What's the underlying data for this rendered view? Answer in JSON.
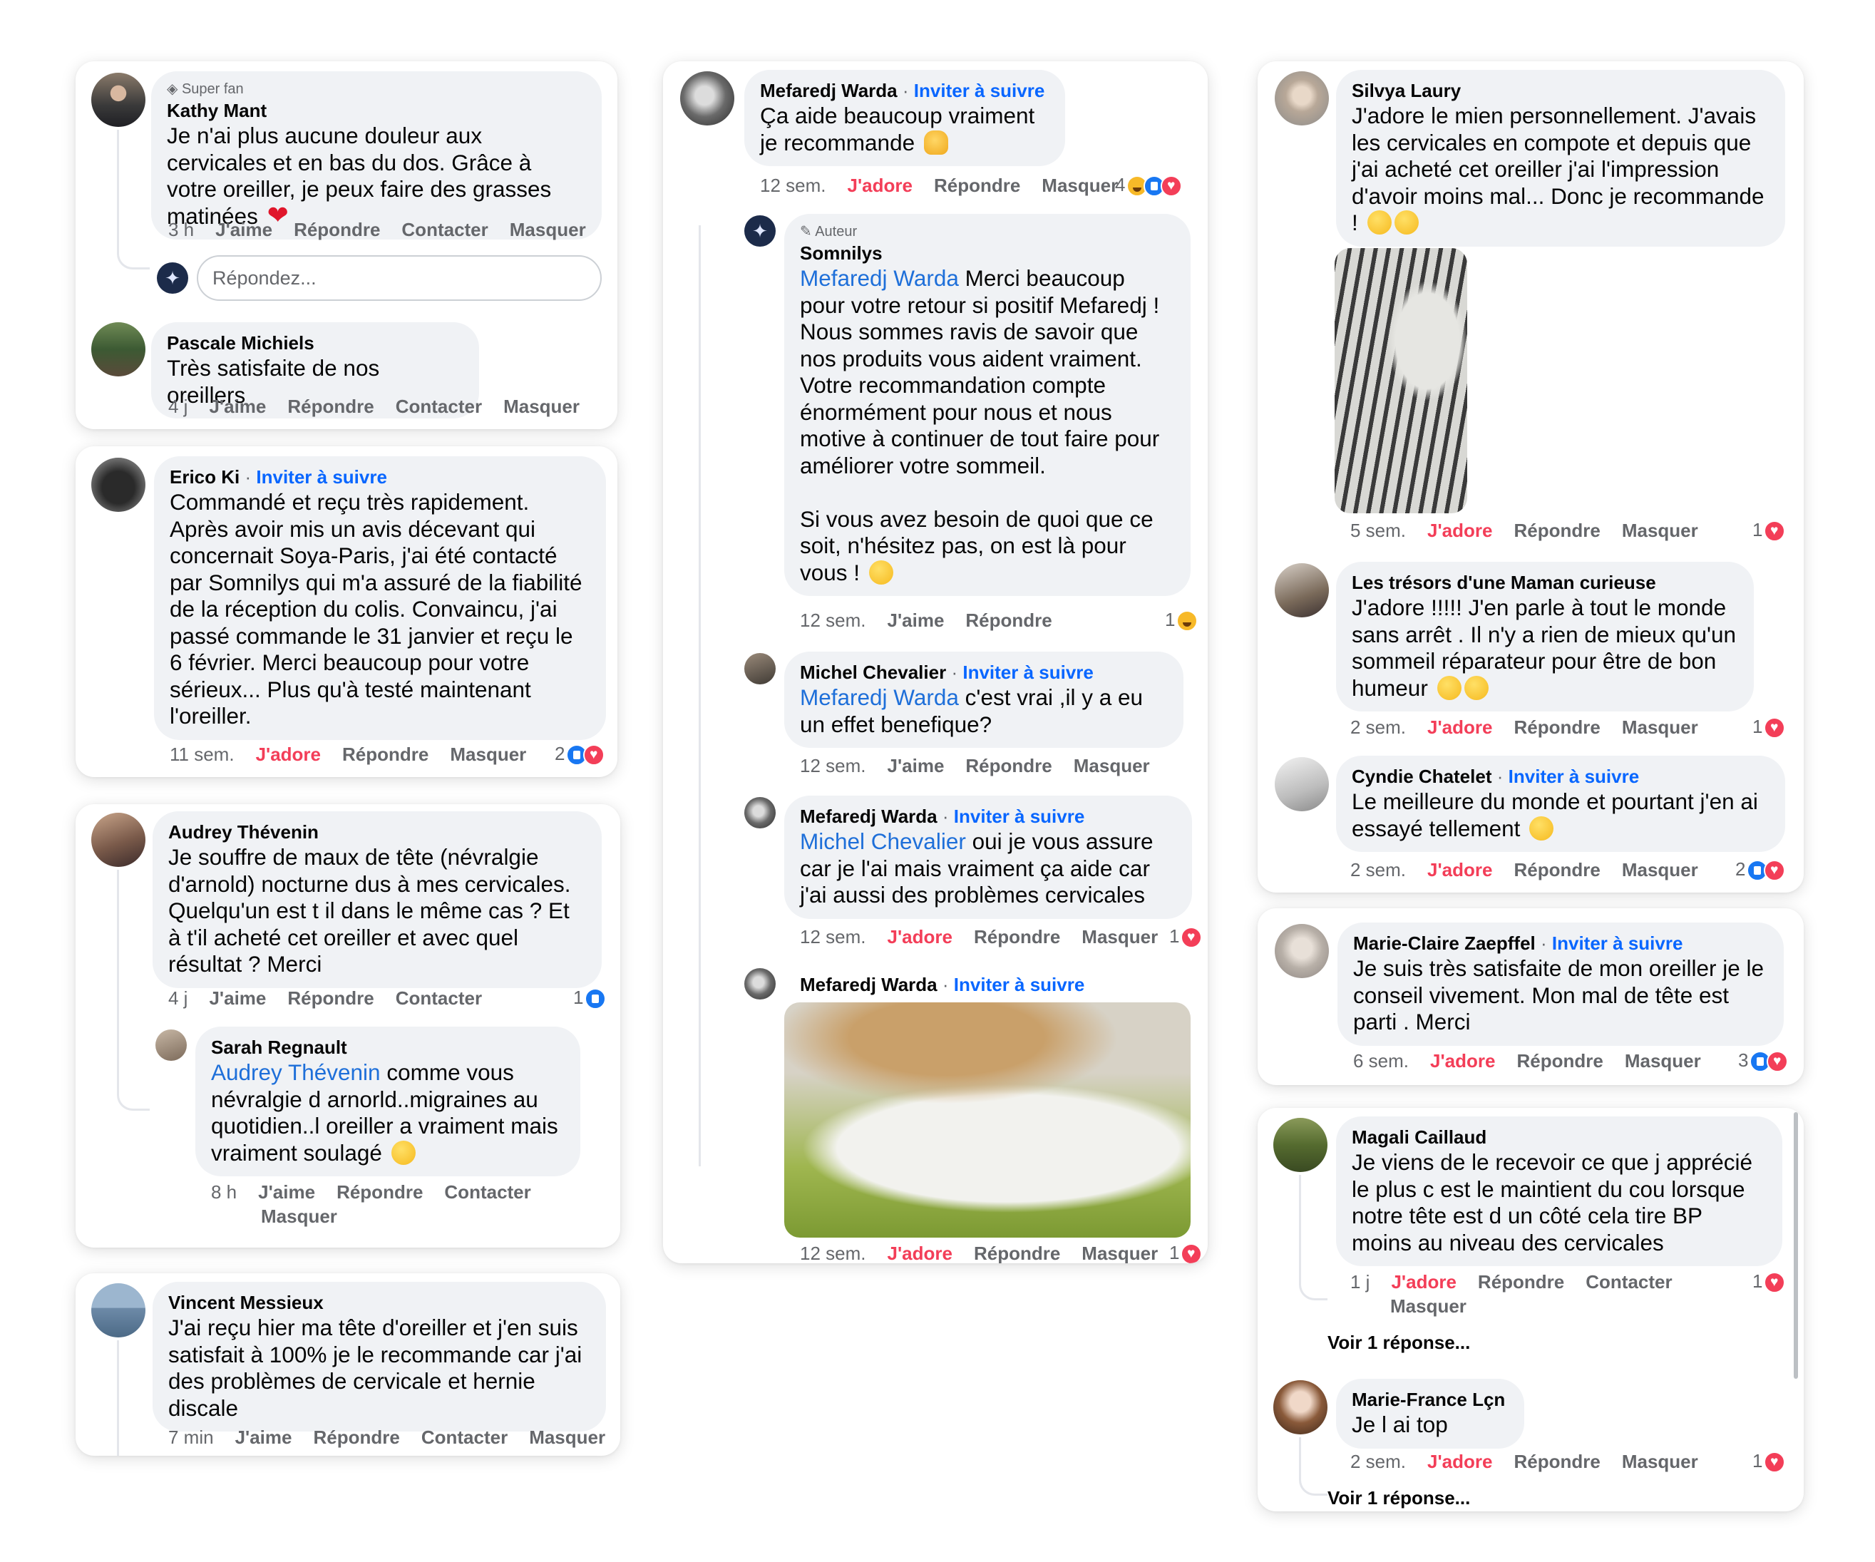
{
  "colors": {
    "accent_blue": "#0866ff",
    "love_red": "#f33e58",
    "bubble": "#f0f2f5",
    "meta_grey": "#65676b"
  },
  "actions": {
    "like": "J'aime",
    "love": "J'adore",
    "reply": "Répondre",
    "contact": "Contacter",
    "hide": "Masquer"
  },
  "kathy": {
    "badge": "Super fan",
    "name": "Kathy Mant",
    "text": "Je n'ai plus aucune douleur aux cervicales et en bas du dos. Grâce à votre oreiller, je peux faire des grasses matinées",
    "time": "3 h",
    "reply_placeholder": "Répondez..."
  },
  "pascale": {
    "name": "Pascale Michiels",
    "text": "Très satisfaite de nos oreillers",
    "time": "4 j"
  },
  "erico": {
    "name": "Erico Ki",
    "follow": "Inviter à suivre",
    "text": "Commandé et reçu très rapidement. Après avoir mis un avis décevant qui concernait Soya-Paris, j'ai été contacté par Somnilys qui m'a assuré de la fiabilité de la réception du colis. Convaincu, j'ai passé commande le 31 janvier et reçu le 6 février. Merci beaucoup pour votre sérieux... Plus qu'à testé maintenant l'oreiller.",
    "time": "11 sem.",
    "count": "2"
  },
  "audrey": {
    "name": "Audrey Thévenin",
    "text": "Je souffre de maux de tête (névralgie d'arnold) nocturne dus à mes cervicales. Quelqu'un est t il dans le même cas ? Et à t'il acheté cet oreiller et avec quel résultat ? Merci",
    "time": "4 j",
    "count": "1"
  },
  "sarah": {
    "name": "Sarah Regnault",
    "mention": "Audrey Thévenin",
    "text": " comme vous névralgie d arnorld..migraines au quotidien..l oreiller a vraiment mais vraiment soulagé",
    "time": "8 h"
  },
  "vincent": {
    "name": "Vincent Messieux",
    "text": "J'ai reçu hier ma tête d'oreiller et j'en suis satisfait à 100% je le recommande car j'ai des problèmes de cervicale et hernie discale",
    "time": "7 min"
  },
  "warda1": {
    "name": "Mefaredj Warda",
    "follow": "Inviter à suivre",
    "text": "Ça aide beaucoup vraiment je recommande",
    "time": "12 sem.",
    "count": "4"
  },
  "somnilys": {
    "badge": "Auteur",
    "name": "Somnilys",
    "mention": "Mefaredj Warda",
    "text": " Merci beaucoup pour votre retour si positif Mefaredj ! Nous sommes ravis de savoir que nos produits vous aident vraiment. Votre recommandation compte énormément pour nous et nous motive à continuer de tout faire pour améliorer votre sommeil.\n\nSi vous avez besoin de quoi que ce soit, n'hésitez pas, on est là pour vous !",
    "time": "12 sem.",
    "count": "1"
  },
  "michel": {
    "name": "Michel Chevalier",
    "follow": "Inviter à suivre",
    "mention": "Mefaredj Warda",
    "text": " c'est vrai ,il y a eu un effet benefique?",
    "time": "12 sem."
  },
  "warda2": {
    "name": "Mefaredj Warda",
    "follow": "Inviter à suivre",
    "mention": "Michel Chevalier",
    "text": " oui je vous assure car je l'ai mais vraiment ça aide car j'ai aussi des problèmes cervicales",
    "time": "12 sem.",
    "count": "1"
  },
  "warda3": {
    "name": "Mefaredj Warda",
    "follow": "Inviter à suivre",
    "time": "12 sem.",
    "count": "1"
  },
  "silvya": {
    "name": "Silvya Laury",
    "text": "J'adore le mien personnellement. J'avais les cervicales en compote et depuis que j'ai acheté cet oreiller j'ai l'impression d'avoir moins mal... Donc je recommande !",
    "time": "5 sem.",
    "count": "1"
  },
  "tresors": {
    "name": "Les trésors d'une Maman curieuse",
    "text": "J'adore !!!!! J'en parle à tout le monde sans arrêt . Il n'y a rien de mieux qu'un sommeil réparateur pour être de bon humeur",
    "time": "2 sem.",
    "count": "1"
  },
  "cyndie": {
    "name": "Cyndie Chatelet",
    "follow": "Inviter à suivre",
    "text": "Le meilleure du monde et pourtant j'en ai essayé tellement",
    "time": "2 sem.",
    "count": "2"
  },
  "marieclaire": {
    "name": "Marie-Claire Zaepffel",
    "follow": "Inviter à suivre",
    "text": "Je suis très satisfaite de mon oreiller je le conseil vivement. Mon mal de tête est parti . Merci",
    "time": "6 sem.",
    "count": "3"
  },
  "magali": {
    "name": "Magali Caillaud",
    "text": "Je viens de le recevoir ce que j apprécié le plus c est le maintient du cou lorsque notre tête est d un côté cela tire BP moins au niveau des cervicales",
    "time": "1 j",
    "count": "1",
    "see_reply": "Voir 1 réponse..."
  },
  "mariefrance": {
    "name": "Marie-France Lçn",
    "text": "Je l ai top",
    "time": "2 sem.",
    "count": "1",
    "see_reply": "Voir 1 réponse..."
  }
}
